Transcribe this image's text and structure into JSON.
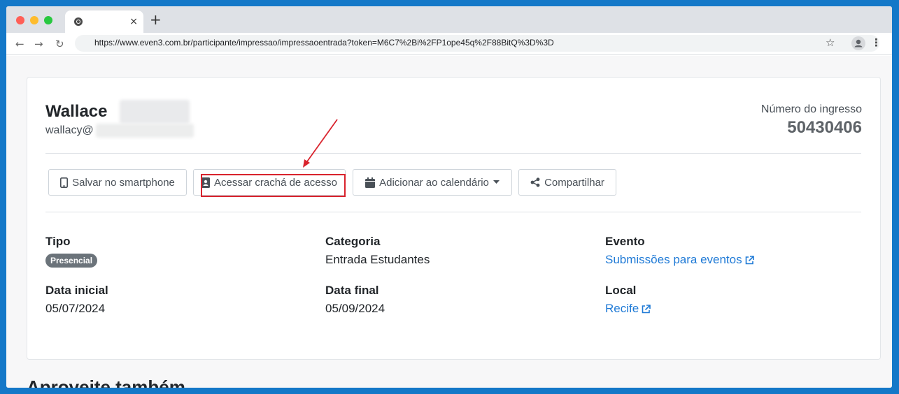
{
  "browser": {
    "url": "https://www.even3.com.br/participante/impressao/impressaoentrada?token=M6C7%2Bi%2FP1ope45q%2F88BitQ%3D%3D",
    "tab_close": "×",
    "new_tab": "+",
    "back": "←",
    "forward": "→",
    "reload": "↻",
    "star": "☆",
    "menu": "⋮"
  },
  "participant": {
    "name": "Wallace",
    "email": "wallacy@"
  },
  "ticket": {
    "label": "Número do ingresso",
    "number": "50430406"
  },
  "actions": {
    "save_smartphone": "Salvar no smartphone",
    "access_badge": "Acessar crachá de acesso",
    "add_calendar": "Adicionar ao calendário",
    "share": "Compartilhar"
  },
  "details": {
    "tipo_label": "Tipo",
    "tipo_value": "Presencial",
    "categoria_label": "Categoria",
    "categoria_value": "Entrada Estudantes",
    "evento_label": "Evento",
    "evento_value": "Submissões para eventos",
    "data_inicial_label": "Data inicial",
    "data_inicial_value": "05/07/2024",
    "data_final_label": "Data final",
    "data_final_value": "05/09/2024",
    "local_label": "Local",
    "local_value": "Recife"
  },
  "footer": {
    "heading": "Aproveite também"
  },
  "colors": {
    "accent_link": "#1f7ad6",
    "highlight": "#d9232d",
    "badge": "#6b737a",
    "frame": "#1478c8"
  }
}
